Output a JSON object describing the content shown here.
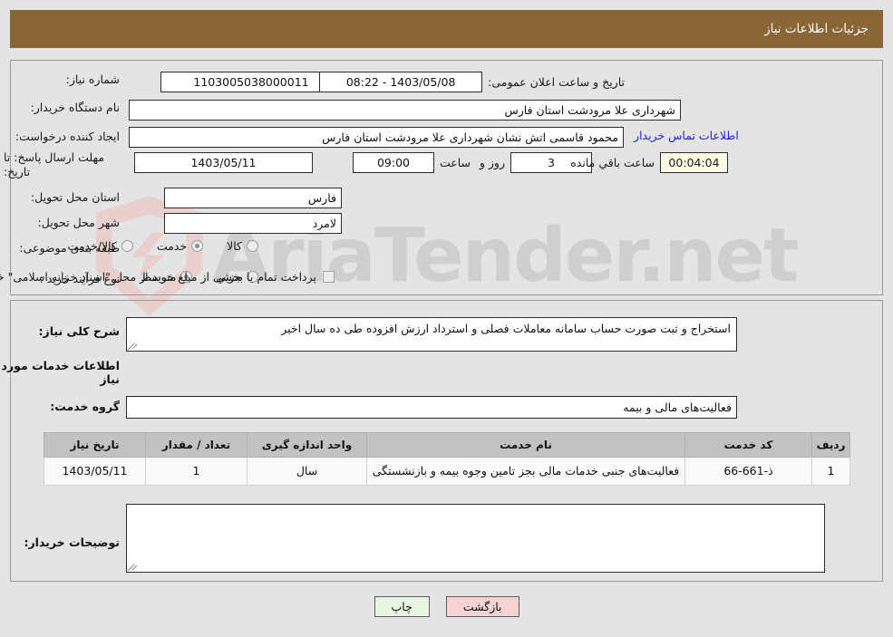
{
  "header": {
    "title": "جزئیات اطلاعات نیاز"
  },
  "form": {
    "need_number_label": "شماره نیاز:",
    "need_number_value": "1103005038000011",
    "announce_datetime_label": "تاریخ و ساعت اعلان عمومی:",
    "announce_datetime_value": "1403/05/08 - 08:22",
    "buyer_org_label": "نام دستگاه خریدار:",
    "buyer_org_value": "شهرداری علا مرودشت استان فارس",
    "requester_label": "ایجاد کننده درخواست:",
    "requester_value": "محمود قاسمی اتش نشان شهرداری علا مرودشت استان فارس",
    "buyer_contact_link": "اطلاعات تماس خریدار",
    "deadline_label": "مهلت ارسال پاسخ: تا تاریخ:",
    "deadline_date": "1403/05/11",
    "hour_label": "ساعت",
    "deadline_time": "09:00",
    "days_value": "3",
    "days_label": "روز و",
    "countdown_value": "00:04:04",
    "countdown_label": "ساعت باقي مانده",
    "province_label": "استان محل تحویل:",
    "province_value": "فارس",
    "city_label": "شهر محل تحویل:",
    "city_value": "لامرد",
    "category_label": "طبقه بندی موضوعی:",
    "category_options": [
      {
        "label": "کالا",
        "selected": false
      },
      {
        "label": "خدمت",
        "selected": true
      },
      {
        "label": "کالا/خدمت",
        "selected": false
      }
    ],
    "process_label": "نوع فرآیند خرید :",
    "process_options": [
      {
        "label": "جزیي",
        "selected": false
      },
      {
        "label": "متوسط",
        "selected": true
      }
    ],
    "treasury_checkbox_checked": false,
    "treasury_note": "پرداخت تمام یا بخشی از مبلغ خرید،از محل \"اسناد خزانه اسلامی\" خواهد بود."
  },
  "description": {
    "need_summary_label": "شرح کلی نیاز:",
    "need_summary_value": "استخراج و ثبت صورت حساب سامانه معاملات فصلی و استرداد ارزش افزوده طی ده سال اخیر",
    "services_section_title": "اطلاعات خدمات مورد نیاز",
    "service_group_label": "گروه خدمت:",
    "service_group_value": "فعالیت‌های مالی و بیمه"
  },
  "table": {
    "columns": [
      "ردیف",
      "کد خدمت",
      "نام خدمت",
      "واحد اندازه گیری",
      "تعداد / مقدار",
      "تاریخ نیاز"
    ],
    "rows": [
      {
        "row_no": "1",
        "service_code": "ذ-661-66",
        "service_name": "فعالیت‌های جنبی خدمات مالی بجز تامین وجوه بیمه و بازنشستگی",
        "unit": "سال",
        "quantity": "1",
        "need_date": "1403/05/11"
      }
    ]
  },
  "buyer_comments": {
    "label": "توضیحات خریدار:",
    "value": ""
  },
  "buttons": {
    "print": "چاپ",
    "back": "بازگشت"
  },
  "watermark": {
    "text": "AriaTender.net"
  },
  "colors": {
    "header_bar": "#8a6536",
    "page_bg": "#e4e4e4",
    "link": "#1d1df0",
    "timer_bg": "#fcfbe5",
    "print_btn_bg": "#e7f5e2",
    "back_btn_bg": "#f8d3d3",
    "table_header_bg": "#c2c2c2"
  }
}
